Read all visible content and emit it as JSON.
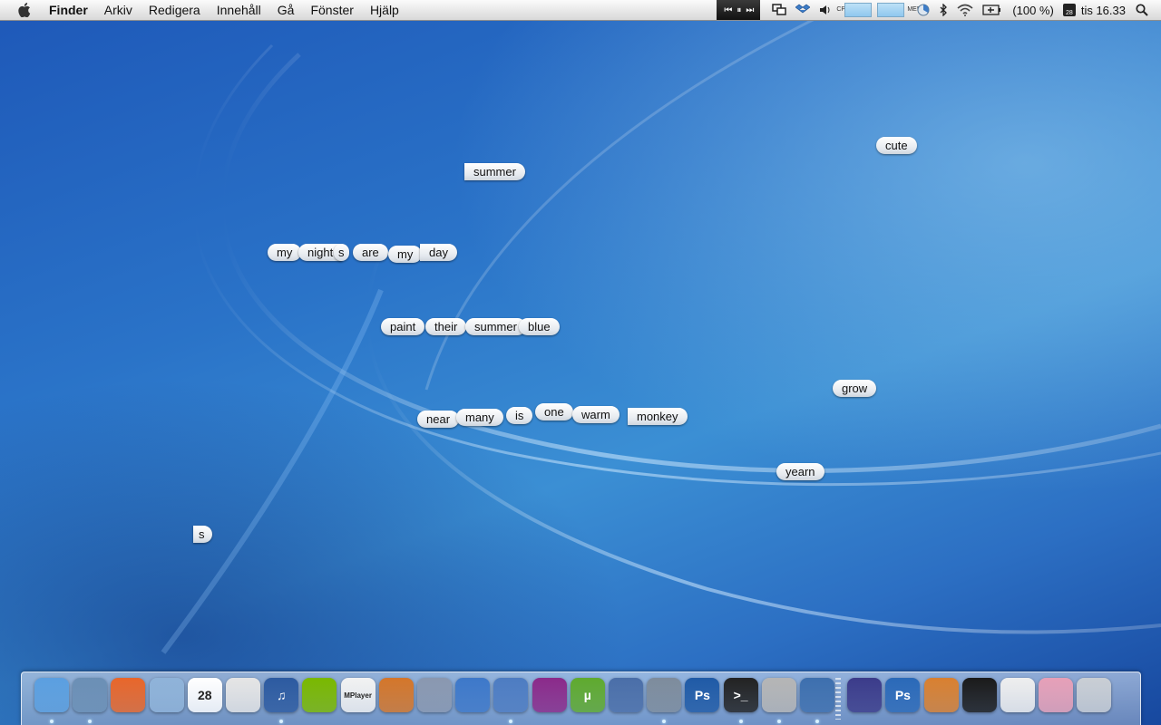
{
  "menubar": {
    "app_name": "Finder",
    "items": [
      "Arkiv",
      "Redigera",
      "Innehåll",
      "Gå",
      "Fönster",
      "Hjälp"
    ],
    "media_controls": [
      "⏮",
      "⏸",
      "⏭"
    ],
    "cpu_label": "CPU",
    "mem_label": "MEM",
    "battery": "(100 %)",
    "calendar_day": "28",
    "clock": "tis 16.33"
  },
  "words": {
    "cute": "cute",
    "summer1": "summer",
    "my1": "my",
    "night": "night",
    "s1": "s",
    "are": "are",
    "my2": "my",
    "day": "day",
    "paint": "paint",
    "their": "their",
    "summer2": "summer",
    "blue": "blue",
    "grow": "grow",
    "near": "near",
    "many": "many",
    "is": "is",
    "one": "one",
    "warm": "warm",
    "monkey": "monkey",
    "yearn": "yearn",
    "s2": "s"
  },
  "dock": {
    "items": [
      {
        "name": "finder-icon",
        "label": "",
        "color": "#5b9fe0",
        "running": true
      },
      {
        "name": "safari-icon",
        "label": "",
        "color": "#6b8fb5",
        "running": true
      },
      {
        "name": "firefox-icon",
        "label": "",
        "color": "#e8662a",
        "running": false
      },
      {
        "name": "mail-stamp-icon",
        "label": "",
        "color": "#8fb3d9",
        "running": false
      },
      {
        "name": "ical-icon",
        "label": "28",
        "color": "#ffffff",
        "running": false
      },
      {
        "name": "adium-icon",
        "label": "",
        "color": "#e5e5e5",
        "running": false
      },
      {
        "name": "itunes-icon",
        "label": "♫",
        "color": "#2c5aa0",
        "running": true
      },
      {
        "name": "spotify-icon",
        "label": "",
        "color": "#7ab800",
        "running": false
      },
      {
        "name": "mplayer-icon",
        "label": "MPlayer",
        "color": "#f2f2f2",
        "running": false
      },
      {
        "name": "keynote-icon",
        "label": "",
        "color": "#d4762a",
        "running": false
      },
      {
        "name": "quill-icon",
        "label": "",
        "color": "#8a98b0",
        "running": false
      },
      {
        "name": "grapher-icon",
        "label": "",
        "color": "#3d78c9",
        "running": false
      },
      {
        "name": "xcode-icon",
        "label": "",
        "color": "#4d7cc2",
        "running": true
      },
      {
        "name": "flower-app-icon",
        "label": "",
        "color": "#8b2a8a",
        "running": false
      },
      {
        "name": "utorrent-icon",
        "label": "µ",
        "color": "#5faa2e",
        "running": false
      },
      {
        "name": "vmware-icon",
        "label": "",
        "color": "#4a6ea8",
        "running": false
      },
      {
        "name": "scale-icon",
        "label": "",
        "color": "#7e8c9c",
        "running": true
      },
      {
        "name": "photoshop-icon",
        "label": "Ps",
        "color": "#1f5aa6",
        "running": false
      },
      {
        "name": "terminal-icon",
        "label": ">_",
        "color": "#222222",
        "running": true
      },
      {
        "name": "keychain-icon",
        "label": "",
        "color": "#b5b5b5",
        "running": true
      },
      {
        "name": "migration-icon",
        "label": "",
        "color": "#3d6fae",
        "running": true
      },
      {
        "name": "eclipse-icon",
        "label": "",
        "color": "#3b3b8a",
        "running": false
      },
      {
        "name": "photoshop-cs-icon",
        "label": "Ps",
        "color": "#2a69b8",
        "running": false
      },
      {
        "name": "keynote2-icon",
        "label": "",
        "color": "#d98030",
        "running": false
      },
      {
        "name": "activity-monitor-icon",
        "label": "",
        "color": "#1a1a1a",
        "running": false
      },
      {
        "name": "document-icon",
        "label": "",
        "color": "#eeeeee",
        "running": false
      },
      {
        "name": "preview-images-icon",
        "label": "",
        "color": "#e6a0b8",
        "running": false
      },
      {
        "name": "trash-icon",
        "label": "",
        "color": "#c9ced4",
        "running": false
      }
    ]
  },
  "colors": {
    "wallpaper_base": "#2a73c8",
    "menubar": "#e6e6e6",
    "word_tile": "#e5e9ee"
  }
}
